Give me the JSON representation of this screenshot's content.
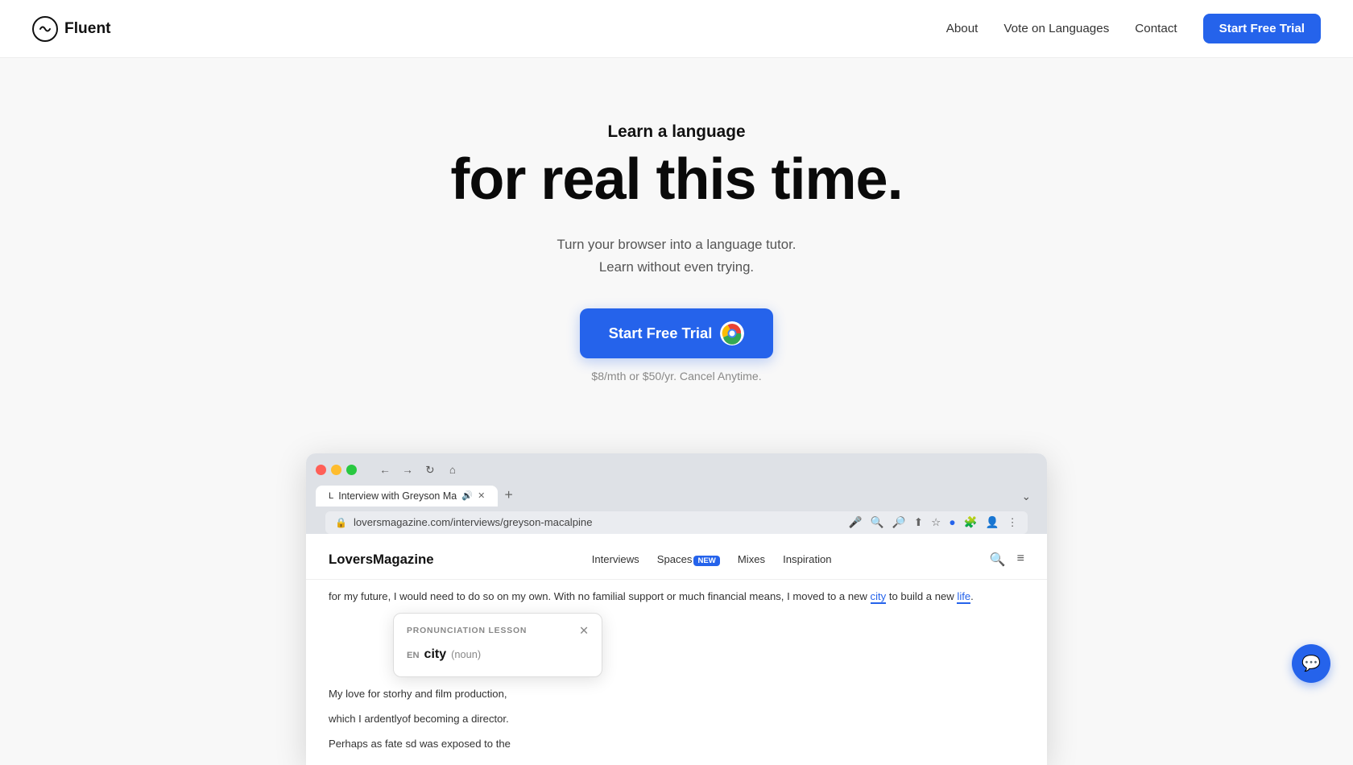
{
  "nav": {
    "logo_text": "Fluent",
    "links": [
      {
        "label": "About",
        "id": "about"
      },
      {
        "label": "Vote on Languages",
        "id": "vote"
      },
      {
        "label": "Contact",
        "id": "contact"
      }
    ],
    "cta_label": "Start Free Trial"
  },
  "hero": {
    "subtitle": "Learn a language",
    "title": "for real this time.",
    "desc_line1": "Turn your browser into a language tutor.",
    "desc_line2": "Learn without even trying.",
    "cta_label": "Start Free Trial",
    "pricing": "$8/mth or $50/yr. Cancel Anytime."
  },
  "browser": {
    "tab_label": "Interview with Greyson Ma",
    "url": "loversmagazine.com/interviews/greyson-macalpine",
    "page_logo": "LoversMagazine",
    "page_nav": [
      "Interviews",
      "Spaces",
      "Mixes",
      "Inspiration"
    ],
    "badge_nav": "Spaces",
    "para1": "for my future, I would need to do so on my own. With no familial support or much financial means, I moved to a new city to build a new life.",
    "para2": "My love for stor",
    "para2_rest": "hy and film production,",
    "para3": "which I ardently",
    "para3_rest": "of becoming a director.",
    "para4": "Perhaps as fate s",
    "para4_rest": "d was exposed to the",
    "popup_label": "PRONUNCIATION LESSON",
    "popup_lang": "EN",
    "popup_word": "city",
    "popup_pos": "(noun)"
  }
}
